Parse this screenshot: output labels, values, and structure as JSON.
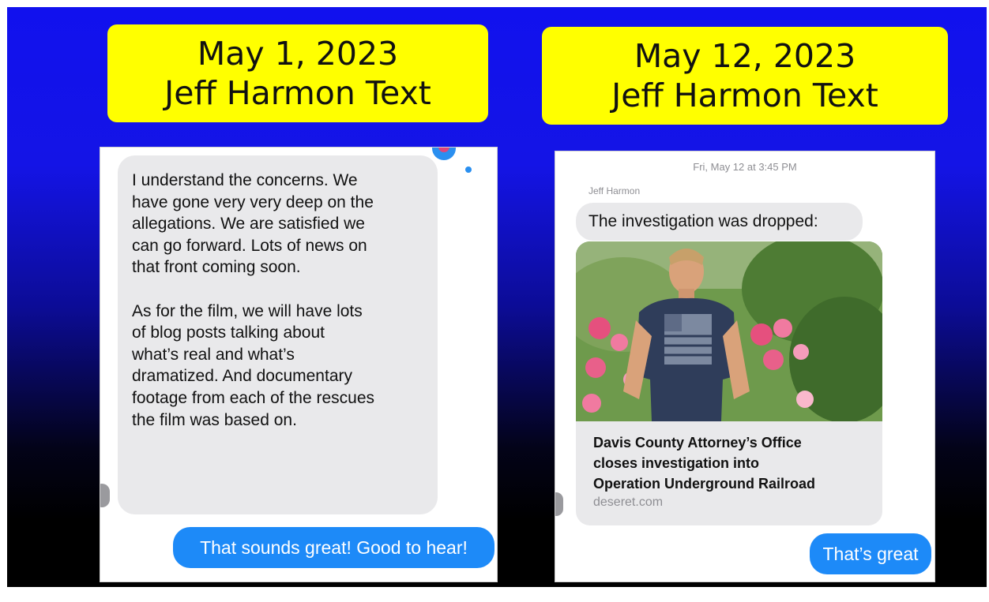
{
  "left_title": {
    "line1": "May 1, 2023",
    "line2": "Jeff Harmon Text"
  },
  "right_title": {
    "line1": "May 12, 2023",
    "line2": "Jeff Harmon Text"
  },
  "left_chat": {
    "incoming_message": "I understand the concerns. We\nhave gone very very deep on the\nallegations. We are satisfied we\ncan go forward. Lots of news on\nthat front coming soon.\n\nAs for the film, we will have lots\nof blog posts talking about\nwhat’s real and what’s\ndramatized. And documentary\nfootage from each of the rescues\nthe film was based on.",
    "reply": "That sounds great! Good to hear!"
  },
  "right_chat": {
    "timestamp": "Fri, May 12 at 3:45 PM",
    "sender": "Jeff Harmon",
    "incoming_message": "The investigation was dropped:",
    "link": {
      "title": "Davis County Attorney’s Office\ncloses investigation into\nOperation Underground Railroad",
      "domain": "deseret.com"
    },
    "reply": "That’s great"
  },
  "colors": {
    "title_background": "#ffff00",
    "outgoing_bubble": "#1d8af8",
    "incoming_bubble": "#e9e9eb"
  }
}
